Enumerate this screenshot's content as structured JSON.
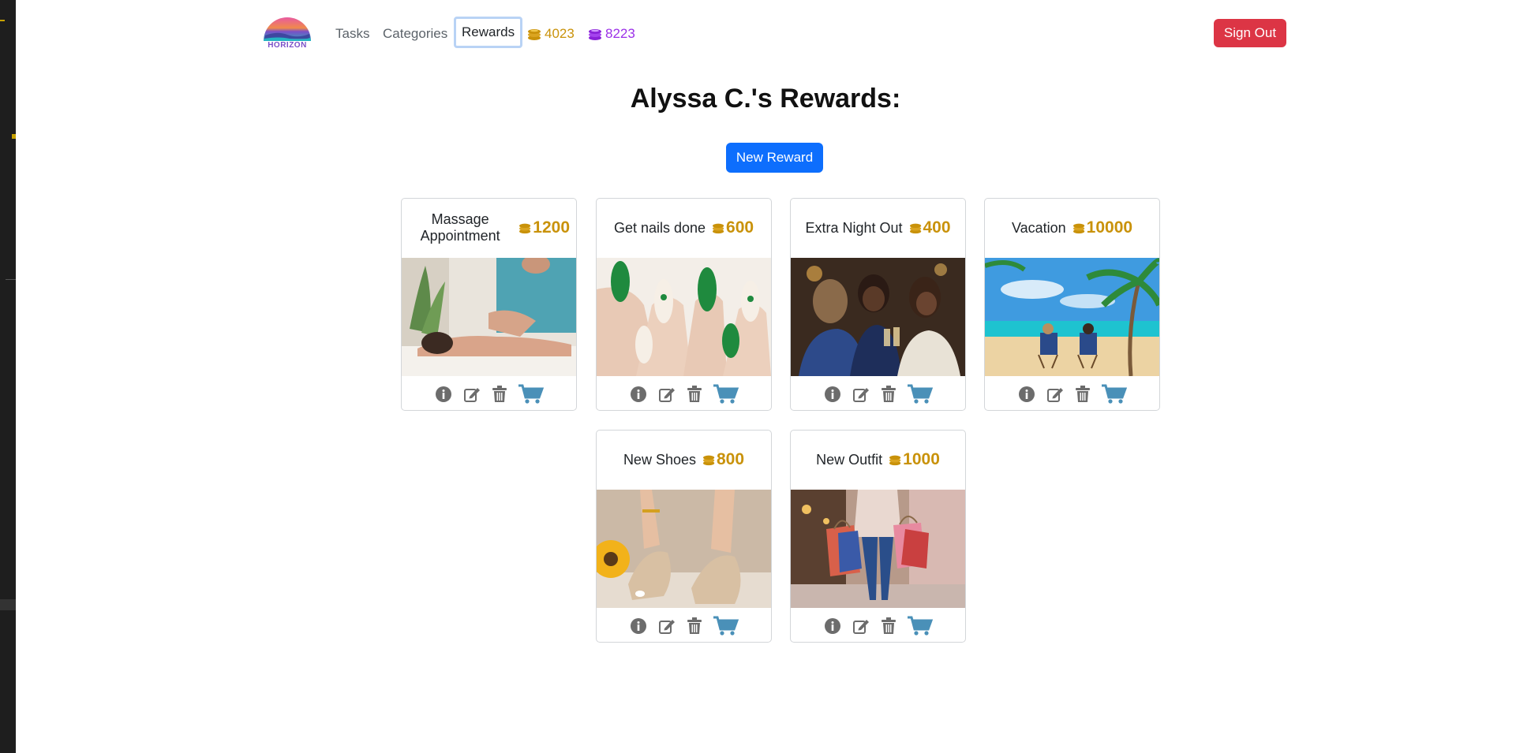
{
  "nav": {
    "logo_text": "HORIZON",
    "links": [
      "Tasks",
      "Categories",
      "Rewards"
    ],
    "active_link": "Rewards",
    "gold_coins": "4023",
    "purple_coins": "8223",
    "sign_out": "Sign Out"
  },
  "page": {
    "title": "Alyssa C.'s Rewards:",
    "new_reward_label": "New Reward"
  },
  "rewards": [
    {
      "name": "Massage Appointment",
      "cost": "1200",
      "image": "massage-photo"
    },
    {
      "name": "Get nails done",
      "cost": "600",
      "image": "green-nails-photo"
    },
    {
      "name": "Extra Night Out",
      "cost": "400",
      "image": "friends-toasting-photo"
    },
    {
      "name": "Vacation",
      "cost": "10000",
      "image": "beach-palm-photo"
    },
    {
      "name": "New Shoes",
      "cost": "800",
      "image": "sandals-photo"
    },
    {
      "name": "New Outfit",
      "cost": "1000",
      "image": "shopping-bags-photo"
    }
  ],
  "card_actions": [
    "info-icon",
    "edit-icon",
    "trash-icon",
    "cart-icon"
  ],
  "colors": {
    "gold": "#c9920a",
    "purple": "#9b30e8",
    "primary": "#0d6efd",
    "danger": "#dc3545",
    "cart": "#4a90b8",
    "action_icon": "#6c6c6c"
  }
}
